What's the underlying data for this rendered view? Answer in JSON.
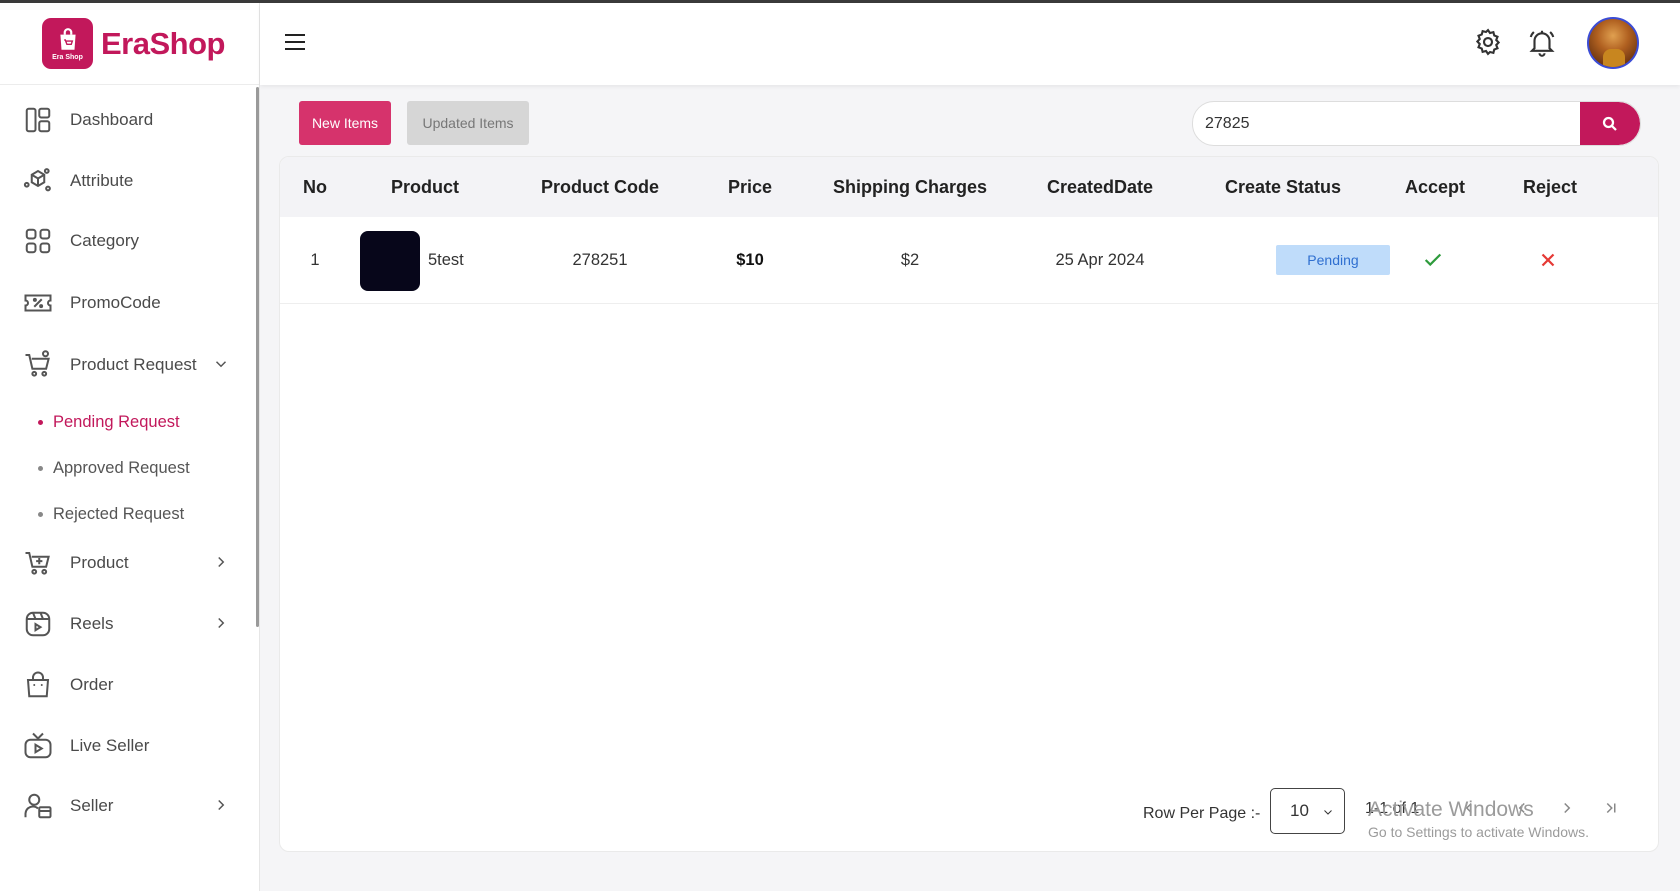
{
  "brand": {
    "name": "EraShop",
    "logo_text": "Era Shop",
    "color": "#c2185b"
  },
  "sidebar": {
    "items": [
      {
        "label": "Dashboard",
        "icon": "dashboard-icon"
      },
      {
        "label": "Attribute",
        "icon": "attribute-icon"
      },
      {
        "label": "Category",
        "icon": "category-icon"
      },
      {
        "label": "PromoCode",
        "icon": "promocode-icon"
      },
      {
        "label": "Product Request",
        "icon": "product-request-icon",
        "expanded": true
      },
      {
        "label": "Product",
        "icon": "product-icon"
      },
      {
        "label": "Reels",
        "icon": "reels-icon"
      },
      {
        "label": "Order",
        "icon": "order-icon"
      },
      {
        "label": "Live Seller",
        "icon": "live-seller-icon"
      },
      {
        "label": "Seller",
        "icon": "seller-icon"
      }
    ],
    "subitems": [
      {
        "label": "Pending Request",
        "active": true
      },
      {
        "label": "Approved Request",
        "active": false
      },
      {
        "label": "Rejected Request",
        "active": false
      }
    ]
  },
  "toolbar": {
    "new_label": "New Items",
    "updated_label": "Updated Items"
  },
  "search": {
    "value": "27825"
  },
  "table": {
    "columns": [
      "No",
      "Product",
      "Product Code",
      "Price",
      "Shipping Charges",
      "CreatedDate",
      "Create Status",
      "Accept",
      "Reject"
    ],
    "rows": [
      {
        "no": "1",
        "product": "5test",
        "code": "278251",
        "price": "$10",
        "shipping": "$2",
        "date": "25 Apr 2024",
        "status": "Pending"
      }
    ]
  },
  "pagination": {
    "label": "Row Per Page :-",
    "rows_per_page": "10",
    "info": "1-1 of 1"
  },
  "watermark": {
    "line1": "Activate Windows",
    "line2": "Go to Settings to activate Windows."
  },
  "colors": {
    "accent": "#c2185b",
    "accept": "#2e9b3c",
    "reject": "#e53935",
    "pending_bg": "#bfdcfa"
  }
}
